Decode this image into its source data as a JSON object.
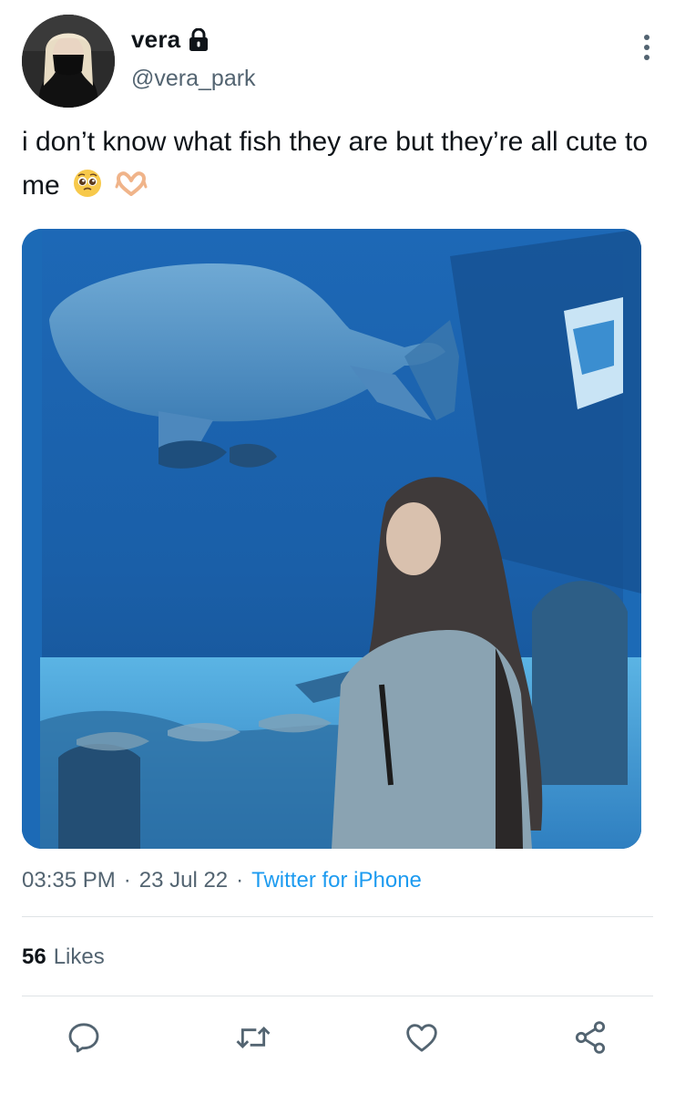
{
  "author": {
    "display_name": "vera",
    "handle": "@vera_park",
    "protected_icon": "lock-icon"
  },
  "tweet": {
    "text": "i don’t know what fish they are but they’re all cute to me",
    "emojis": [
      "pleading-face-emoji",
      "heart-hands-emoji"
    ]
  },
  "media": {
    "description_icon": "photo"
  },
  "meta": {
    "time": "03:35 PM",
    "separator": "·",
    "date": "23 Jul 22",
    "source": "Twitter for iPhone"
  },
  "stats": {
    "likes_count": "56",
    "likes_label": "Likes"
  },
  "actions": {
    "reply_icon": "reply-icon",
    "retweet_icon": "retweet-icon",
    "like_icon": "heart-icon",
    "share_icon": "share-icon"
  },
  "colors": {
    "text_primary": "#0f1419",
    "text_secondary": "#536471",
    "link": "#1d9bf0",
    "divider": "#dfe3e6"
  }
}
